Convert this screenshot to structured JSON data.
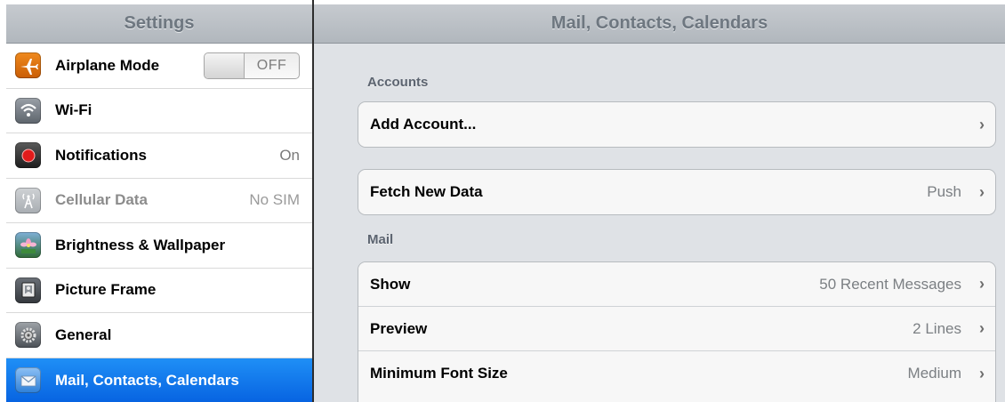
{
  "master": {
    "title": "Settings",
    "items": [
      {
        "label": "Airplane Mode",
        "toggle": "OFF",
        "icon": "airplane-icon"
      },
      {
        "label": "Wi-Fi",
        "detail": "",
        "icon": "wifi-icon"
      },
      {
        "label": "Notifications",
        "detail": "On",
        "icon": "notifications-icon"
      },
      {
        "label": "Cellular Data",
        "detail": "No SIM",
        "icon": "cellular-icon"
      },
      {
        "label": "Brightness & Wallpaper",
        "detail": "",
        "icon": "flower-icon"
      },
      {
        "label": "Picture Frame",
        "detail": "",
        "icon": "picture-frame-icon"
      },
      {
        "label": "General",
        "detail": "",
        "icon": "gear-icon"
      },
      {
        "label": "Mail, Contacts, Calendars",
        "detail": "",
        "icon": "mail-icon"
      }
    ]
  },
  "detail": {
    "title": "Mail, Contacts, Calendars",
    "sections": {
      "accounts": {
        "header": "Accounts",
        "add_account": "Add Account...",
        "fetch_label": "Fetch New Data",
        "fetch_value": "Push"
      },
      "mail": {
        "header": "Mail",
        "rows": [
          {
            "label": "Show",
            "value": "50 Recent Messages"
          },
          {
            "label": "Preview",
            "value": "2 Lines"
          },
          {
            "label": "Minimum Font Size",
            "value": "Medium"
          }
        ]
      }
    }
  },
  "colors": {
    "selection": "#0a6ae6",
    "navbar": "#b9bec4",
    "detail_bg": "#dfe2e6"
  }
}
